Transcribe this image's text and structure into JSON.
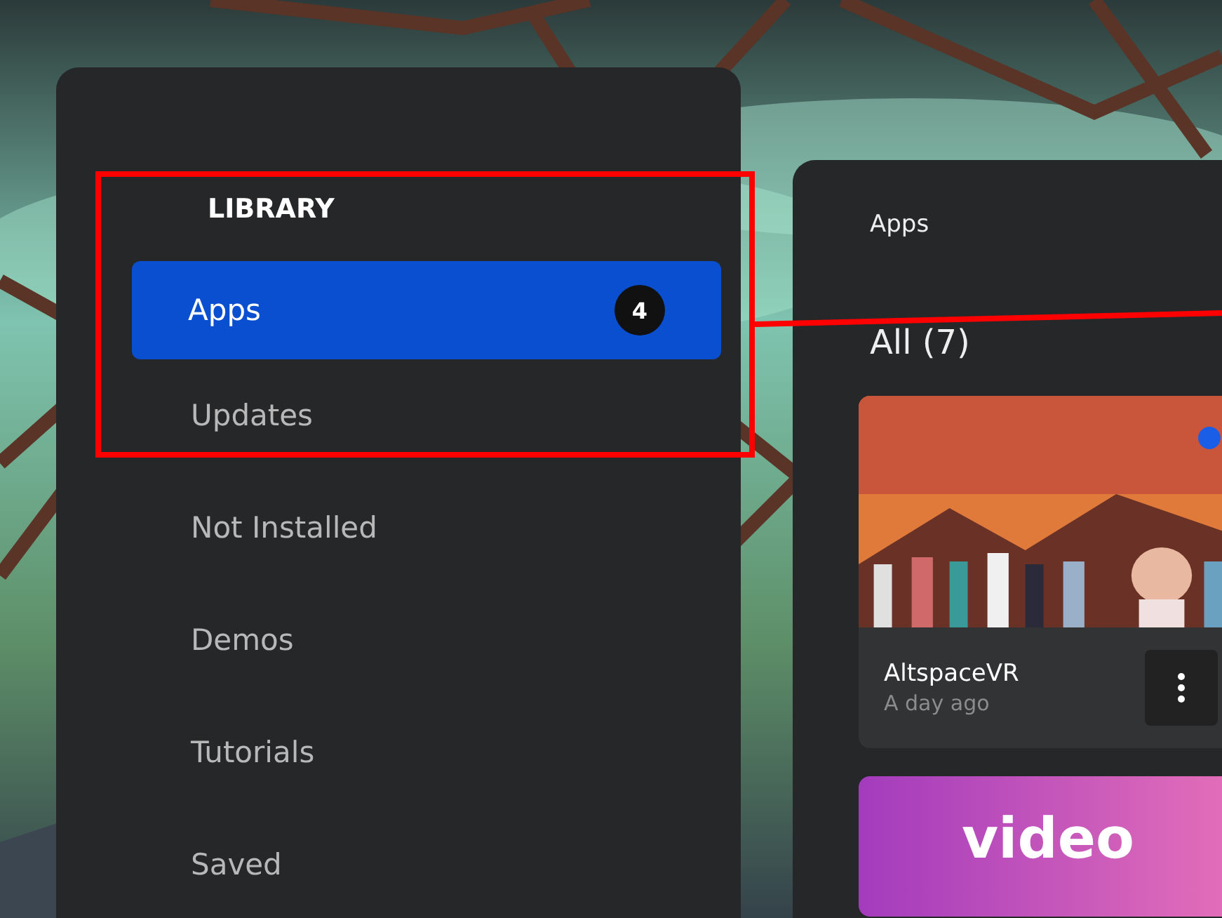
{
  "sidebar": {
    "heading": "LIBRARY",
    "items": [
      {
        "label": "Apps",
        "selected": true,
        "badge": "4"
      },
      {
        "label": "Updates",
        "selected": false
      },
      {
        "label": "Not Installed",
        "selected": false
      },
      {
        "label": "Demos",
        "selected": false
      },
      {
        "label": "Tutorials",
        "selected": false
      },
      {
        "label": "Saved",
        "selected": false
      }
    ]
  },
  "content": {
    "title": "Apps",
    "filter": "All (7)",
    "cards": [
      {
        "kind": "app",
        "name": "AltspaceVR",
        "subtitle": "A day ago",
        "unread": true
      },
      {
        "kind": "promo",
        "thumbnail_text": "video"
      }
    ]
  },
  "annotation": {
    "highlight": true
  }
}
